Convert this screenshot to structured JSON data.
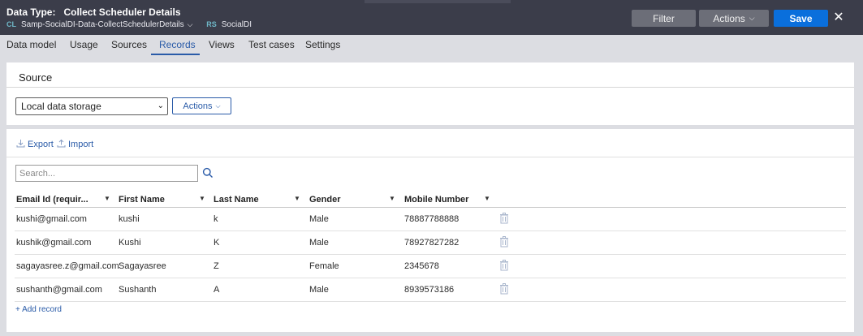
{
  "header": {
    "data_type_label": "Data Type:",
    "title": "Collect Scheduler Details",
    "class_tag": "CL",
    "class_name": "Samp-SocialDI-Data-CollectSchedulerDetails",
    "ruleset_tag": "RS",
    "ruleset_name": "SocialDI",
    "filter_label": "Filter",
    "actions_label": "Actions",
    "save_label": "Save",
    "close_symbol": "✕"
  },
  "tabs": [
    {
      "label": "Data model"
    },
    {
      "label": "Usage"
    },
    {
      "label": "Sources"
    },
    {
      "label": "Records"
    },
    {
      "label": "Views"
    },
    {
      "label": "Test cases"
    },
    {
      "label": "Settings"
    }
  ],
  "active_tab": "Records",
  "source": {
    "title": "Source",
    "storage_value": "Local data storage",
    "actions_label": "Actions"
  },
  "records": {
    "export_label": "Export",
    "import_label": "Import",
    "search_placeholder": "Search...",
    "columns": [
      "Email Id (requir...",
      "First Name",
      "Last Name",
      "Gender",
      "Mobile Number"
    ],
    "rows": [
      [
        "kushi@gmail.com",
        "kushi",
        "k",
        "Male",
        "78887788888"
      ],
      [
        "kushik@gmail.com",
        "Kushi",
        "K",
        "Male",
        "78927827282"
      ],
      [
        "sagayasree.z@gmail.com",
        "Sagayasree",
        "Z",
        "Female",
        "2345678"
      ],
      [
        "sushanth@gmail.com",
        "Sushanth",
        "A",
        "Male",
        "8939573186"
      ]
    ],
    "add_record_label": "+ Add record"
  },
  "colors": {
    "header_bg": "#3b3d4a",
    "accent_blue": "#2a5ba8",
    "save_blue": "#0a6fdc",
    "page_bg": "#dcdde2"
  },
  "icons": [
    "chevron-down-icon",
    "close-icon",
    "export-icon",
    "import-icon",
    "search-icon",
    "filter-icon",
    "trash-icon"
  ]
}
